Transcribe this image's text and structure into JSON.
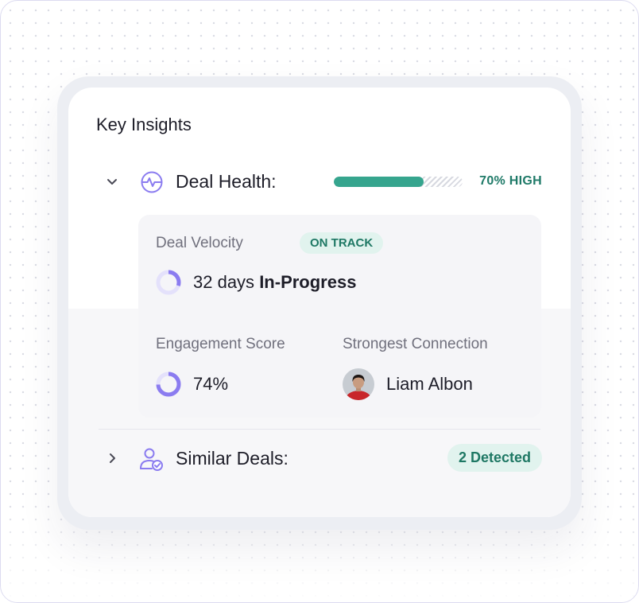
{
  "card": {
    "title": "Key Insights"
  },
  "deal_health": {
    "label": "Deal Health:",
    "icon": "activity-pulse-icon",
    "progress": 0.7,
    "status": "70% HIGH",
    "expanded": true
  },
  "deal_velocity": {
    "label": "Deal Velocity",
    "badge": "ON TRACK",
    "value": "32 days",
    "value_strong": "In-Progress",
    "ring_fraction": 0.3
  },
  "engagement": {
    "label": "Engagement Score",
    "value": "74%",
    "ring_fraction": 0.74
  },
  "connection": {
    "label": "Strongest Connection",
    "name": "Liam Albon"
  },
  "similar_deals": {
    "label": "Similar Deals:",
    "icon": "user-check-icon",
    "badge": "2 Detected",
    "expanded": false
  },
  "colors": {
    "accent_purple": "#8b7cf0",
    "ring_track": "#e4e1fb",
    "health_green": "#36a58e",
    "badge_bg": "#e1f3ee",
    "badge_text": "#1e7864"
  }
}
